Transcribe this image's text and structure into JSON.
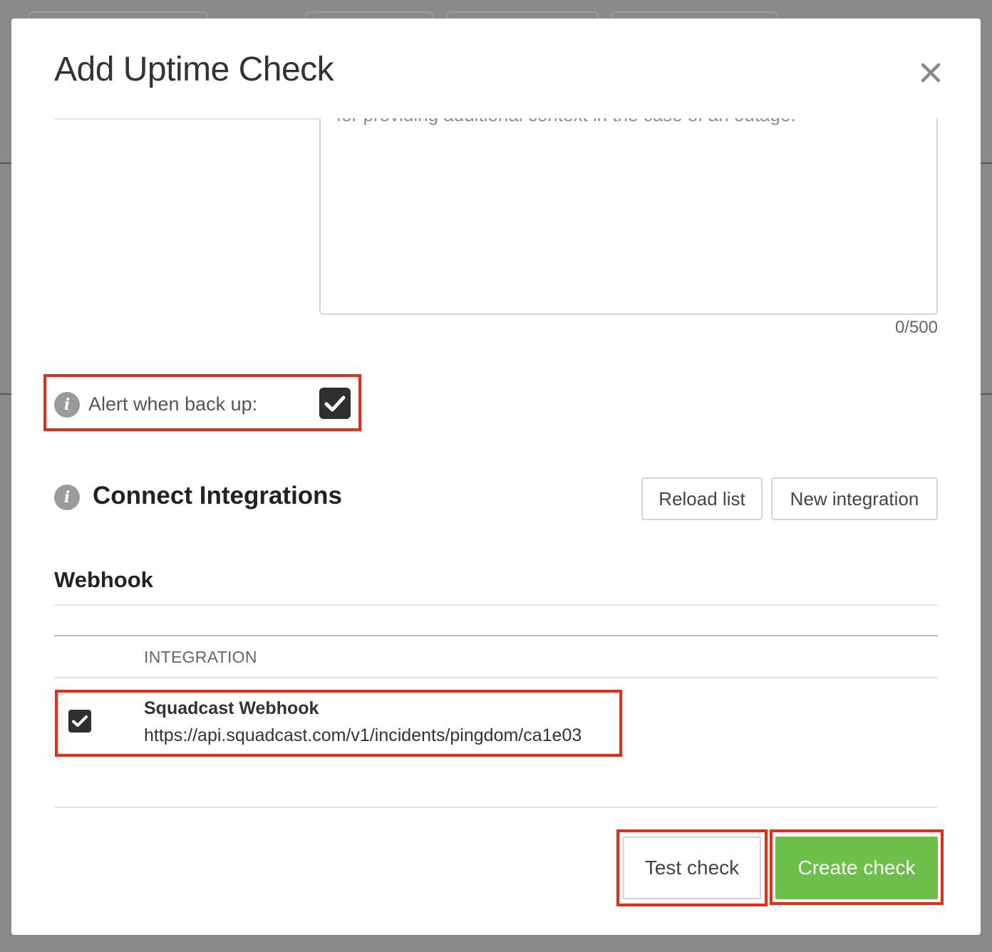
{
  "modal": {
    "title": "Add Uptime Check",
    "close_icon": "close-icon"
  },
  "description": {
    "text": "for providing additional context in the case of an outage.",
    "counter": "0/500"
  },
  "alert_back_up": {
    "label": "Alert when back up:",
    "checked": true,
    "icon": "info-icon"
  },
  "integrations": {
    "title": "Connect Integrations",
    "reload_label": "Reload list",
    "new_label": "New integration",
    "group_title": "Webhook",
    "column_header": "INTEGRATION",
    "rows": [
      {
        "name": "Squadcast Webhook",
        "url": "https://api.squadcast.com/v1/incidents/pingdom/ca1e03",
        "checked": true
      }
    ]
  },
  "footer": {
    "test_label": "Test check",
    "create_label": "Create check"
  },
  "colors": {
    "primary_green": "#6cc04a",
    "highlight_red": "#ee2a10",
    "checkbox_dark": "#2f2f2f"
  }
}
